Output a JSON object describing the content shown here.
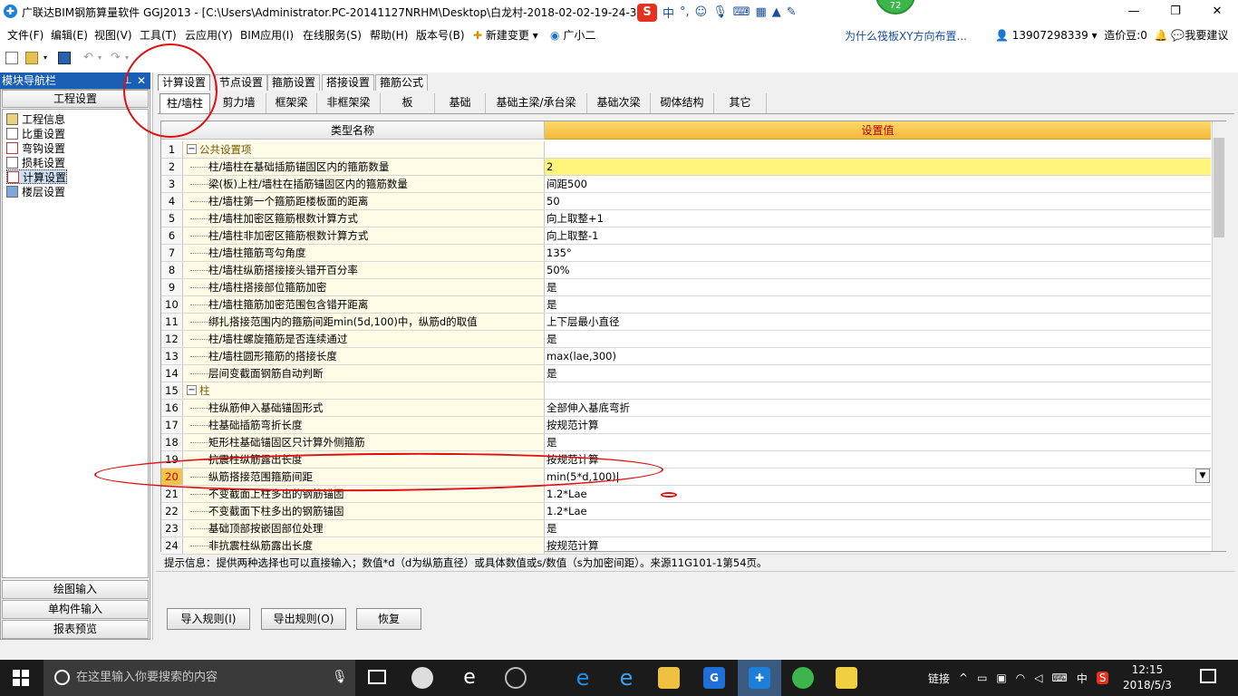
{
  "window": {
    "title": "广联达BIM钢筋算量软件 GGJ2013 - [C:\\Users\\Administrator.PC-20141127NRHM\\Desktop\\白龙村-2018-02-02-19-24-35",
    "badge": "72",
    "min": "—",
    "max": "❐",
    "close": "✕"
  },
  "ime": {
    "logo": "S",
    "lang": "中",
    "punct": "°,"
  },
  "menu": [
    "文件(F)",
    "编辑(E)",
    "视图(V)",
    "工具(T)",
    "云应用(Y)",
    "BIM应用(I)",
    "在线服务(S)",
    "帮助(H)",
    "版本号(B)",
    "新建变更",
    "广小二"
  ],
  "menu_arrow": "▾",
  "tip_link": "为什么筏板XY方向布置...",
  "account": {
    "phone": "13907298339",
    "arrow": "▾",
    "coins": "造价豆:0",
    "feedback": "我要建议"
  },
  "nav": {
    "header": "模块导航栏",
    "pin": "⊥",
    "close": "✕",
    "section": "工程设置",
    "items": [
      "工程信息",
      "比重设置",
      "弯钩设置",
      "损耗设置",
      "计算设置",
      "楼层设置"
    ],
    "buttons": [
      "绘图输入",
      "单构件输入",
      "报表预览"
    ]
  },
  "top_tabs": [
    "计算设置",
    "节点设置",
    "箍筋设置",
    "搭接设置",
    "箍筋公式"
  ],
  "sub_tabs": [
    "柱/墙柱",
    "剪力墙",
    "框架梁",
    "非框架梁",
    "板",
    "基础",
    "基础主梁/承台梁",
    "基础次梁",
    "砌体结构",
    "其它"
  ],
  "grid": {
    "col_name": "类型名称",
    "col_value": "设置值",
    "expand": "−",
    "rows": [
      {
        "n": "1",
        "name": "公共设置项",
        "value": "",
        "group": true
      },
      {
        "n": "2",
        "name": "柱/墙柱在基础插筋锚固区内的箍筋数量",
        "value": "2",
        "sel": true
      },
      {
        "n": "3",
        "name": "梁(板)上柱/墙柱在插筋锚固区内的箍筋数量",
        "value": "间距500"
      },
      {
        "n": "4",
        "name": "柱/墙柱第一个箍筋距楼板面的距离",
        "value": "50"
      },
      {
        "n": "5",
        "name": "柱/墙柱加密区箍筋根数计算方式",
        "value": "向上取整+1"
      },
      {
        "n": "6",
        "name": "柱/墙柱非加密区箍筋根数计算方式",
        "value": "向上取整-1"
      },
      {
        "n": "7",
        "name": "柱/墙柱箍筋弯勾角度",
        "value": "135°"
      },
      {
        "n": "8",
        "name": "柱/墙柱纵筋搭接接头错开百分率",
        "value": "50%"
      },
      {
        "n": "9",
        "name": "柱/墙柱搭接部位箍筋加密",
        "value": "是"
      },
      {
        "n": "10",
        "name": "柱/墙柱箍筋加密范围包含错开距离",
        "value": "是"
      },
      {
        "n": "11",
        "name": "绑扎搭接范围内的箍筋间距min(5d,100)中，纵筋d的取值",
        "value": "上下层最小直径"
      },
      {
        "n": "12",
        "name": "柱/墙柱螺旋箍筋是否连续通过",
        "value": "是"
      },
      {
        "n": "13",
        "name": "柱/墙柱圆形箍筋的搭接长度",
        "value": "max(lae,300)"
      },
      {
        "n": "14",
        "name": "层间变截面钢筋自动判断",
        "value": "是"
      },
      {
        "n": "15",
        "name": "柱",
        "value": "",
        "group": true
      },
      {
        "n": "16",
        "name": "柱纵筋伸入基础锚固形式",
        "value": "全部伸入基底弯折"
      },
      {
        "n": "17",
        "name": "柱基础插筋弯折长度",
        "value": "按规范计算"
      },
      {
        "n": "18",
        "name": "矩形柱基础锚固区只计算外侧箍筋",
        "value": "是"
      },
      {
        "n": "19",
        "name": "抗震柱纵筋露出长度",
        "value": "按规范计算"
      },
      {
        "n": "20",
        "name": "纵筋搭接范围箍筋间距",
        "value": "min(5*d,100)|",
        "cur": true
      },
      {
        "n": "21",
        "name": "不变截面上柱多出的钢筋锚固",
        "value": "1.2*Lae"
      },
      {
        "n": "22",
        "name": "不变截面下柱多出的钢筋锚固",
        "value": "1.2*Lae"
      },
      {
        "n": "23",
        "name": "基础顶部按嵌固部位处理",
        "value": "是"
      },
      {
        "n": "24",
        "name": "非抗震柱纵筋露出长度",
        "value": "按规范计算"
      }
    ]
  },
  "hint": "提示信息：提供两种选择也可以直接输入；数值*d（d为纵筋直径）或具体数值或s/数值（s为加密间距）。来源11G101-1第54页。",
  "bottom_buttons": [
    "导入规则(I)",
    "导出规则(O)",
    "恢复"
  ],
  "taskbar": {
    "search_placeholder": "在这里输入你要搜索的内容",
    "tray_link": "链接",
    "tray_lang": "中",
    "time": "12:15",
    "date": "2018/5/3"
  }
}
